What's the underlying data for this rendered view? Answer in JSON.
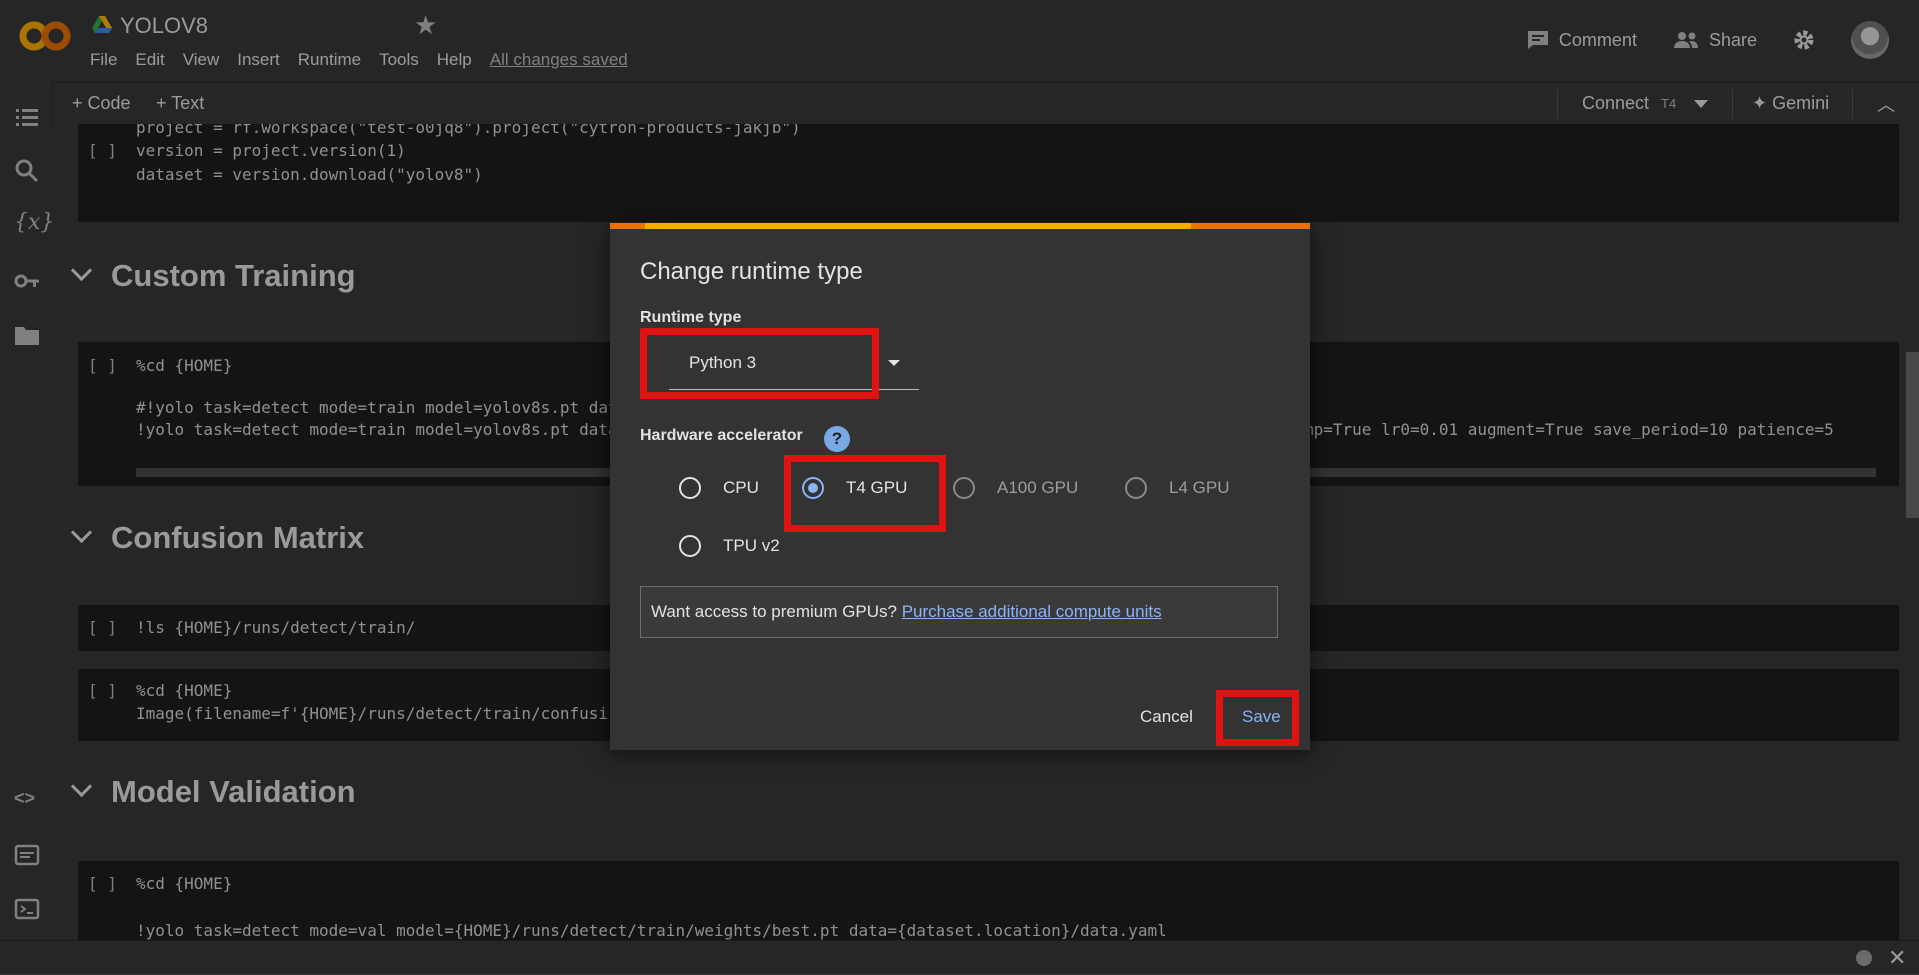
{
  "header": {
    "title": "YOLOV8",
    "menu": [
      "File",
      "Edit",
      "View",
      "Insert",
      "Runtime",
      "Tools",
      "Help"
    ],
    "saved_status": "All changes saved",
    "comment_label": "Comment",
    "share_label": "Share"
  },
  "toolbar": {
    "code_label": "+ Code",
    "text_label": "+ Text",
    "connect_label": "Connect",
    "runtime_badge": "T4",
    "gemini_label": "✦ Gemini"
  },
  "notebook": {
    "cell1": {
      "bracket": "[ ]",
      "lines": [
        "project = rf.workspace(\"test-o0jq8\").project(\"cytron-products-jakjb\")",
        "version = project.version(1)",
        "dataset = version.download(\"yolov8\")"
      ]
    },
    "section1": "Custom Training",
    "cell2": {
      "bracket": "[ ]",
      "line1": "%cd {HOME}",
      "line2": "#!yolo task=detect mode=train model=yolov8s.pt dat",
      "line3": "!yolo task=detect mode=train model=yolov8s.pt data",
      "line3_tail": "mp=True lr0=0.01 augment=True save_period=10 patience=5"
    },
    "section2": "Confusion Matrix",
    "cell3": {
      "bracket": "[ ]",
      "line1": "!ls {HOME}/runs/detect/train/"
    },
    "cell4": {
      "bracket": "[ ]",
      "line1": "%cd {HOME}",
      "line2": "Image(filename=f'{HOME}/runs/detect/train/confusi"
    },
    "section3": "Model Validation",
    "cell5": {
      "bracket": "[ ]",
      "line1": "%cd {HOME}",
      "line2": "!yolo task=detect mode=val model={HOME}/runs/detect/train/weights/best.pt data={dataset.location}/data.yaml"
    }
  },
  "dialog": {
    "title": "Change runtime type",
    "runtime_label": "Runtime type",
    "runtime_value": "Python 3",
    "hardware_label": "Hardware accelerator",
    "help_glyph": "?",
    "options": [
      {
        "label": "CPU",
        "selected": false,
        "enabled": true
      },
      {
        "label": "T4 GPU",
        "selected": true,
        "enabled": true
      },
      {
        "label": "A100 GPU",
        "selected": false,
        "enabled": false
      },
      {
        "label": "L4 GPU",
        "selected": false,
        "enabled": false
      },
      {
        "label": "TPU v2",
        "selected": false,
        "enabled": true
      }
    ],
    "premium_question": "Want access to premium GPUs?",
    "premium_link": "Purchase additional compute units",
    "cancel_label": "Cancel",
    "save_label": "Save"
  },
  "colors": {
    "accent_blue": "#8ab4f8",
    "highlight_red": "#e01313",
    "orange_bar": "#f9ab00"
  }
}
